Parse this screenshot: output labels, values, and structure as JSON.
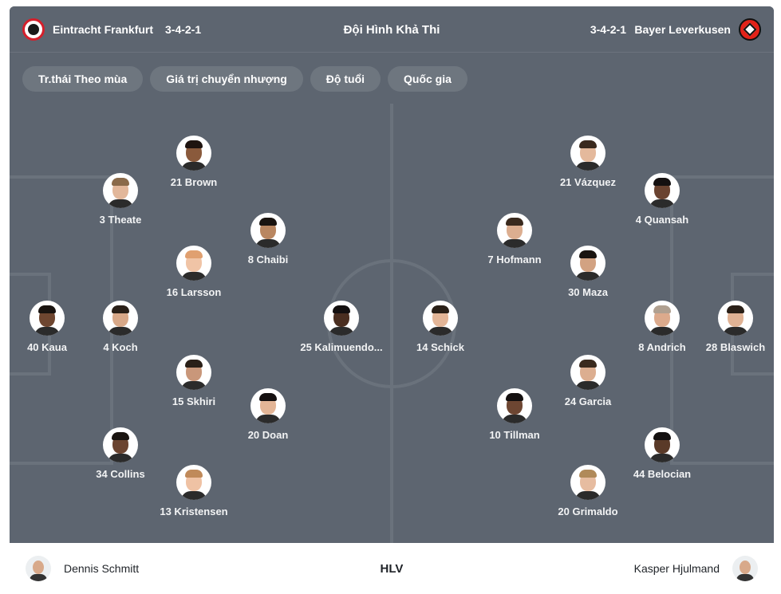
{
  "header": {
    "title": "Đội Hình Khả Thi",
    "home": {
      "name": "Eintracht Frankfurt",
      "formation": "3-4-2-1",
      "crest_icon": "eintracht-frankfurt-crest-icon",
      "color": "#d51f2b"
    },
    "away": {
      "name": "Bayer Leverkusen",
      "formation": "3-4-2-1",
      "crest_icon": "bayer-leverkusen-crest-icon",
      "color": "#e32219"
    }
  },
  "filters": [
    {
      "label": "Tr.thái Theo mùa"
    },
    {
      "label": "Giá trị chuyển nhượng"
    },
    {
      "label": "Độ tuổi"
    },
    {
      "label": "Quốc gia"
    }
  ],
  "home_players": [
    {
      "label": "21 Brown",
      "skin": "#8a5a3c",
      "hair": "#1e1410"
    },
    {
      "label": "3 Theate",
      "skin": "#e2b79a",
      "hair": "#8a6a4a"
    },
    {
      "label": "8 Chaibi",
      "skin": "#b98660",
      "hair": "#1a1410"
    },
    {
      "label": "16 Larsson",
      "skin": "#f0c4a6",
      "hair": "#e0a070"
    },
    {
      "label": "40 Kaua",
      "skin": "#6e4630",
      "hair": "#1a1410"
    },
    {
      "label": "4 Koch",
      "skin": "#d8a888",
      "hair": "#2a2018"
    },
    {
      "label": "25 Kalimuendo...",
      "skin": "#4a2e20",
      "hair": "#141010"
    },
    {
      "label": "15 Skhiri",
      "skin": "#c9977a",
      "hair": "#2a2018"
    },
    {
      "label": "20 Doan",
      "skin": "#e3b596",
      "hair": "#141010"
    },
    {
      "label": "34 Collins",
      "skin": "#6b4430",
      "hair": "#1a1410"
    },
    {
      "label": "13 Kristensen",
      "skin": "#efc2a4",
      "hair": "#c08a5a"
    }
  ],
  "away_players": [
    {
      "label": "21 Vázquez",
      "skin": "#e4b99c",
      "hair": "#3a2a1e"
    },
    {
      "label": "4 Quansah",
      "skin": "#6a4330",
      "hair": "#141010"
    },
    {
      "label": "7 Hofmann",
      "skin": "#dcae90",
      "hair": "#3a2a1e"
    },
    {
      "label": "30 Maza",
      "skin": "#d2a282",
      "hair": "#1a1410"
    },
    {
      "label": "14 Schick",
      "skin": "#e3b597",
      "hair": "#2a2018"
    },
    {
      "label": "8 Andrich",
      "skin": "#dcaa8c",
      "hair": "#b0a090"
    },
    {
      "label": "28 Blaswich",
      "skin": "#e0b294",
      "hair": "#2a2018"
    },
    {
      "label": "24 Garcia",
      "skin": "#dcae90",
      "hair": "#3a2a1e"
    },
    {
      "label": "10 Tillman",
      "skin": "#6d4632",
      "hair": "#141010"
    },
    {
      "label": "44 Belocian",
      "skin": "#5a3a28",
      "hair": "#141010"
    },
    {
      "label": "20 Grimaldo",
      "skin": "#e6bca0",
      "hair": "#b08a5a"
    }
  ],
  "footer": {
    "label": "HLV",
    "home_coach": "Dennis Schmitt",
    "away_coach": "Kasper Hjulmand"
  }
}
